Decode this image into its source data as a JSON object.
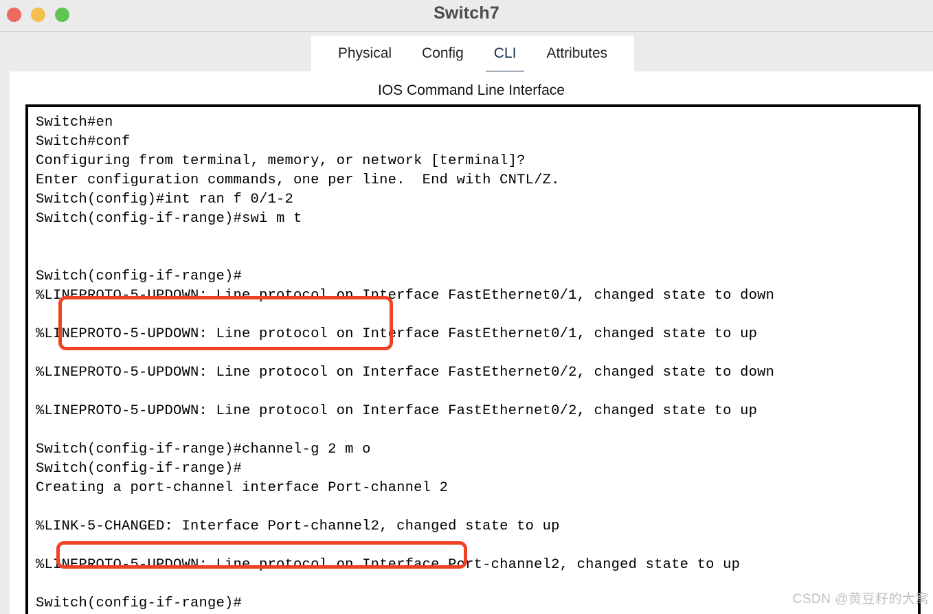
{
  "window": {
    "title": "Switch7",
    "traffic_lights": [
      {
        "name": "close-button",
        "color": "#ec6a5e"
      },
      {
        "name": "minimize-button",
        "color": "#f5bf4f"
      },
      {
        "name": "maximize-button",
        "color": "#61c554"
      }
    ]
  },
  "tabs": [
    {
      "label": "Physical",
      "active": false
    },
    {
      "label": "Config",
      "active": false
    },
    {
      "label": "CLI",
      "active": true
    },
    {
      "label": "Attributes",
      "active": false
    }
  ],
  "active_tab_color": "#16314f",
  "main": {
    "heading": "IOS Command Line Interface"
  },
  "terminal": {
    "lines": [
      "Switch#en",
      "Switch#conf",
      "Configuring from terminal, memory, or network [terminal]?",
      "Enter configuration commands, one per line.  End with CNTL/Z.",
      "Switch(config)#int ran f 0/1-2",
      "Switch(config-if-range)#swi m t",
      "",
      "",
      "Switch(config-if-range)#",
      "%LINEPROTO-5-UPDOWN: Line protocol on Interface FastEthernet0/1, changed state to down",
      "",
      "%LINEPROTO-5-UPDOWN: Line protocol on Interface FastEthernet0/1, changed state to up",
      "",
      "%LINEPROTO-5-UPDOWN: Line protocol on Interface FastEthernet0/2, changed state to down",
      "",
      "%LINEPROTO-5-UPDOWN: Line protocol on Interface FastEthernet0/2, changed state to up",
      "",
      "Switch(config-if-range)#channel-g 2 m o",
      "Switch(config-if-range)#",
      "Creating a port-channel interface Port-channel 2",
      "",
      "%LINK-5-CHANGED: Interface Port-channel2, changed state to up",
      "",
      "%LINEPROTO-5-UPDOWN: Line protocol on Interface Port-channel2, changed state to up",
      "",
      "Switch(config-if-range)#"
    ]
  },
  "annotations": {
    "color": "#ef4123",
    "boxes": [
      {
        "name": "highlight-int-range-commands"
      },
      {
        "name": "highlight-channel-group-command"
      }
    ]
  },
  "watermark": {
    "text": "CSDN @黄豆籽的大窝"
  }
}
